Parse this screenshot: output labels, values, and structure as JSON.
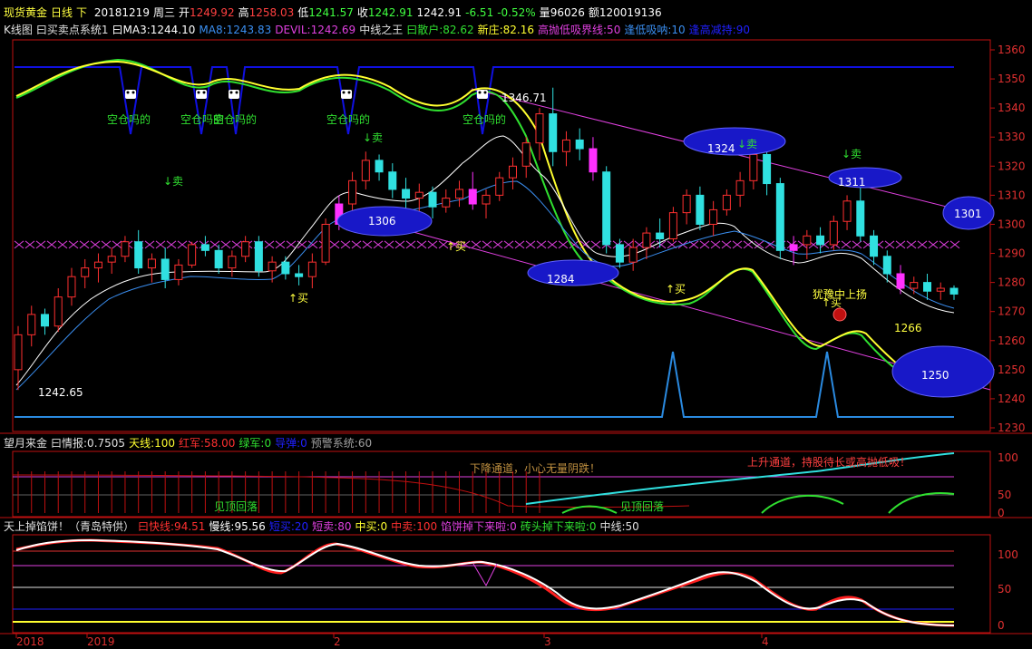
{
  "title_bar": {
    "symbol": "现货黄金",
    "period": "日线",
    "direction": "下",
    "date": "20181219",
    "weekday": "周三",
    "open_label": "开",
    "open": "1249.92",
    "high_label": "高",
    "high": "1258.03",
    "low_label": "低",
    "low": "1241.57",
    "close_label": "收",
    "close": "1242.91",
    "last": "1242.91",
    "change": "-6.51",
    "change_pct": "-0.52%",
    "volume_label": "量",
    "volume": "96026",
    "amount_label": "额",
    "amount": "120019136"
  },
  "panel1_header": [
    {
      "text": "K线图",
      "color": "#e0e0e0"
    },
    {
      "text": "曰买卖点系统1",
      "color": "#e0e0e0"
    },
    {
      "text": "曰MA3:1244.10",
      "color": "#ffffff"
    },
    {
      "text": "MA8:1243.83",
      "color": "#3a8ef0"
    },
    {
      "text": "DEVIL:1242.69",
      "color": "#e040e0"
    },
    {
      "text": "中线之王",
      "color": "#e0e0e0"
    },
    {
      "text": "曰散户:82.62",
      "color": "#30e030"
    },
    {
      "text": "新庄:82.16",
      "color": "#ffff30"
    },
    {
      "text": "高抛低吸界线:50",
      "color": "#e040e0"
    },
    {
      "text": "逢低吸呐:10",
      "color": "#3a8ef0"
    },
    {
      "text": "逢高减持:90",
      "color": "#2020ff"
    }
  ],
  "panel2_header": [
    {
      "text": "望月来金",
      "color": "#e0e0e0"
    },
    {
      "text": "曰情报:0.7505",
      "color": "#e0e0e0"
    },
    {
      "text": "天线:100",
      "color": "#ffff30"
    },
    {
      "text": "红军:58.00",
      "color": "#ff3030"
    },
    {
      "text": "绿军:0",
      "color": "#30e030"
    },
    {
      "text": "导弹:0",
      "color": "#2020ff"
    },
    {
      "text": "预警系统:60",
      "color": "#a0a0a0"
    }
  ],
  "panel3_header": [
    {
      "text": "天上掉馅饼！（青岛特供）",
      "color": "#e0e0e0"
    },
    {
      "text": "曰快线:94.51",
      "color": "#ff3030"
    },
    {
      "text": "慢线:95.56",
      "color": "#ffffff"
    },
    {
      "text": "短买:20",
      "color": "#2020ff"
    },
    {
      "text": "短卖:80",
      "color": "#e040e0"
    },
    {
      "text": "中买:0",
      "color": "#ffff30"
    },
    {
      "text": "中卖:100",
      "color": "#ff3030"
    },
    {
      "text": "馅饼掉下来啦:0",
      "color": "#e040e0"
    },
    {
      "text": "砖头掉下来啦:0",
      "color": "#30e030"
    },
    {
      "text": "中线:50",
      "color": "#e0e0e0"
    }
  ],
  "price_axis": [
    "1360",
    "1350",
    "1340",
    "1330",
    "1320",
    "1310",
    "1300",
    "1290",
    "1280",
    "1270",
    "1260",
    "1250",
    "1240",
    "1230"
  ],
  "ind_axis": [
    "100",
    "50",
    "0"
  ],
  "x_axis": [
    "2018",
    "2019",
    "2",
    "3",
    "4"
  ],
  "annotations": {
    "low_mark": "1242.65",
    "high_mark": "1346.71",
    "ell_1306": "1306",
    "ell_1284": "1284",
    "ell_1324": "1324",
    "ell_1311": "1311",
    "ell_1301": "1301",
    "ell_1250": "1250",
    "lbl_1266": "1266",
    "sell": "↓卖",
    "buy": "↑买",
    "kong": "空仓吗的",
    "rise": "犹豫中上扬",
    "down_channel": "下降通道，小心无量阴跌！",
    "up_channel": "上升通道，持股待长或高抛低吸！",
    "top_fall": "见顶回落"
  },
  "chart_data": {
    "type": "candlestick",
    "title": "现货黄金 日线",
    "ylim": [
      1230,
      1365
    ],
    "candles": [
      [
        1250,
        1265,
        1243,
        1262
      ],
      [
        1262,
        1272,
        1258,
        1269
      ],
      [
        1269,
        1271,
        1262,
        1265
      ],
      [
        1265,
        1278,
        1263,
        1275
      ],
      [
        1275,
        1285,
        1272,
        1282
      ],
      [
        1282,
        1288,
        1278,
        1285
      ],
      [
        1285,
        1290,
        1280,
        1287
      ],
      [
        1287,
        1292,
        1283,
        1289
      ],
      [
        1289,
        1296,
        1287,
        1294
      ],
      [
        1294,
        1298,
        1283,
        1285
      ],
      [
        1285,
        1290,
        1280,
        1288
      ],
      [
        1288,
        1292,
        1278,
        1281
      ],
      [
        1281,
        1288,
        1279,
        1286
      ],
      [
        1286,
        1294,
        1285,
        1293
      ],
      [
        1293,
        1296,
        1289,
        1291
      ],
      [
        1291,
        1293,
        1283,
        1285
      ],
      [
        1285,
        1291,
        1282,
        1289
      ],
      [
        1289,
        1296,
        1287,
        1294
      ],
      [
        1294,
        1296,
        1282,
        1284
      ],
      [
        1284,
        1289,
        1280,
        1287
      ],
      [
        1287,
        1289,
        1281,
        1283
      ],
      [
        1283,
        1286,
        1279,
        1282
      ],
      [
        1282,
        1290,
        1278,
        1287
      ],
      [
        1287,
        1302,
        1286,
        1300
      ],
      [
        1300,
        1310,
        1298,
        1307
      ],
      [
        1307,
        1318,
        1304,
        1315
      ],
      [
        1315,
        1325,
        1312,
        1322
      ],
      [
        1322,
        1324,
        1315,
        1318
      ],
      [
        1318,
        1321,
        1309,
        1312
      ],
      [
        1312,
        1316,
        1305,
        1309
      ],
      [
        1309,
        1314,
        1303,
        1311
      ],
      [
        1311,
        1313,
        1302,
        1306
      ],
      [
        1306,
        1312,
        1304,
        1309
      ],
      [
        1309,
        1315,
        1306,
        1312
      ],
      [
        1312,
        1318,
        1305,
        1307
      ],
      [
        1307,
        1312,
        1302,
        1310
      ],
      [
        1310,
        1318,
        1308,
        1316
      ],
      [
        1316,
        1323,
        1312,
        1320
      ],
      [
        1320,
        1330,
        1316,
        1328
      ],
      [
        1328,
        1340,
        1322,
        1338
      ],
      [
        1338,
        1347,
        1320,
        1325
      ],
      [
        1325,
        1332,
        1320,
        1329
      ],
      [
        1329,
        1333,
        1322,
        1326
      ],
      [
        1326,
        1330,
        1315,
        1318
      ],
      [
        1318,
        1320,
        1290,
        1293
      ],
      [
        1293,
        1295,
        1285,
        1287
      ],
      [
        1287,
        1295,
        1284,
        1292
      ],
      [
        1292,
        1299,
        1288,
        1297
      ],
      [
        1297,
        1302,
        1292,
        1295
      ],
      [
        1295,
        1306,
        1294,
        1304
      ],
      [
        1304,
        1312,
        1300,
        1310
      ],
      [
        1310,
        1313,
        1298,
        1300
      ],
      [
        1300,
        1308,
        1296,
        1305
      ],
      [
        1305,
        1312,
        1303,
        1310
      ],
      [
        1310,
        1318,
        1306,
        1315
      ],
      [
        1315,
        1327,
        1312,
        1324
      ],
      [
        1324,
        1328,
        1310,
        1314
      ],
      [
        1314,
        1316,
        1288,
        1291
      ],
      [
        1291,
        1296,
        1286,
        1293
      ],
      [
        1293,
        1298,
        1288,
        1296
      ],
      [
        1296,
        1299,
        1290,
        1293
      ],
      [
        1293,
        1303,
        1291,
        1301
      ],
      [
        1301,
        1310,
        1298,
        1308
      ],
      [
        1308,
        1313,
        1294,
        1296
      ],
      [
        1296,
        1298,
        1286,
        1289
      ],
      [
        1289,
        1291,
        1280,
        1283
      ],
      [
        1283,
        1286,
        1276,
        1278
      ],
      [
        1278,
        1282,
        1276,
        1280
      ],
      [
        1280,
        1283,
        1274,
        1277
      ],
      [
        1277,
        1280,
        1274,
        1278
      ],
      [
        1278,
        1279,
        1274,
        1276
      ]
    ]
  }
}
